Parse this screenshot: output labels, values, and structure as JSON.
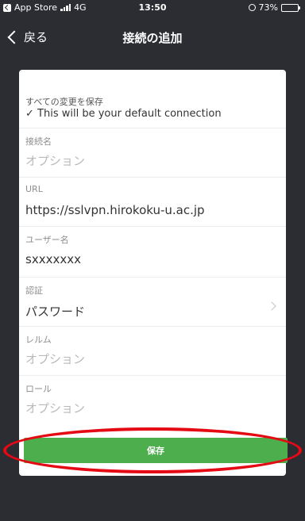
{
  "status_bar": {
    "back_app": "App Store",
    "network": "4G",
    "time": "13:50",
    "battery": "73%",
    "battery_level": 0.73
  },
  "nav": {
    "back_label": "戻る",
    "title": "接続の追加"
  },
  "form": {
    "save_all": {
      "label": "すべての変更を保存",
      "note": "✓ This will be your default connection"
    },
    "connection_name": {
      "label": "接続名",
      "placeholder": "オプション"
    },
    "url": {
      "label": "URL",
      "value": "https://sslvpn.hirokoku-u.ac.jp"
    },
    "username": {
      "label": "ユーザー名",
      "value": "sxxxxxxx"
    },
    "auth": {
      "label": "認証",
      "value": "パスワード"
    },
    "realm": {
      "label": "レルム",
      "placeholder": "オプション"
    },
    "role": {
      "label": "ロール",
      "placeholder": "オプション"
    }
  },
  "save_button": {
    "label": "保存",
    "color": "#4cae4c"
  },
  "highlight_color": "#e50914"
}
